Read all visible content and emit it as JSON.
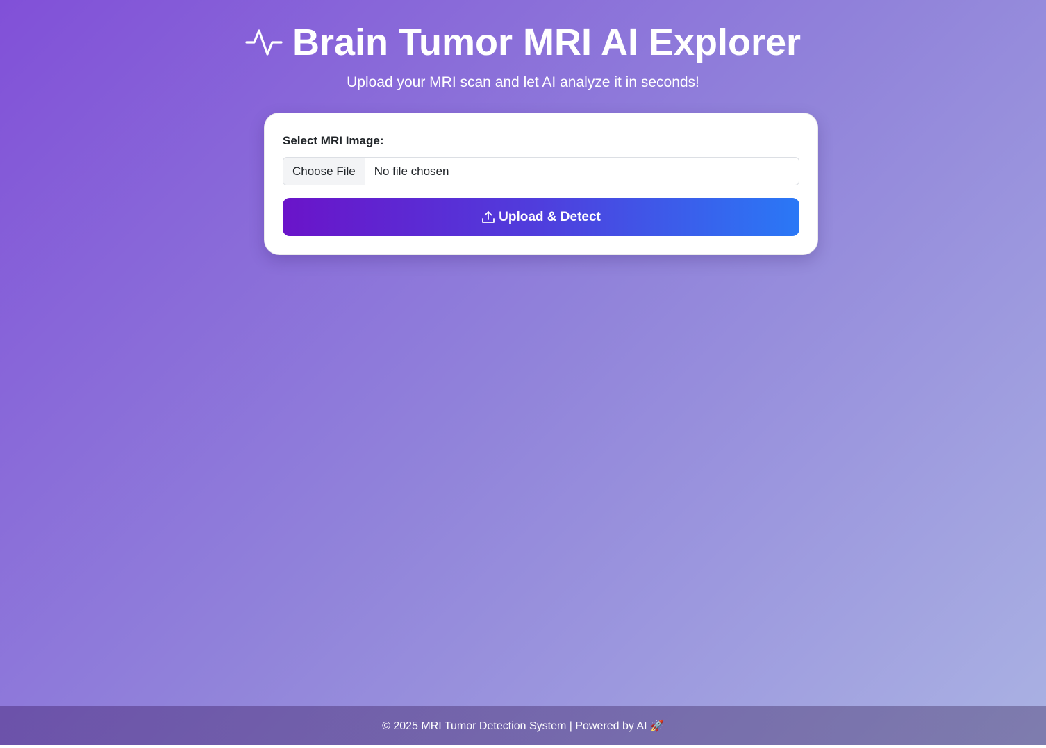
{
  "header": {
    "title": "Brain Tumor MRI AI Explorer",
    "title_icon": "pulse-icon",
    "subtitle": "Upload your MRI scan and let AI analyze it in seconds!"
  },
  "form": {
    "label": "Select MRI Image:",
    "choose_file_label": "Choose File",
    "file_status": "No file chosen",
    "upload_button_label": "Upload & Detect",
    "upload_icon": "upload-icon"
  },
  "footer": {
    "text": "© 2025 MRI Tumor Detection System | Powered by AI 🚀"
  },
  "colors": {
    "background_start": "#8150d8",
    "background_end": "#aab2e3",
    "button_start": "#6a14c9",
    "button_end": "#2a78f6",
    "card": "#ffffff"
  }
}
